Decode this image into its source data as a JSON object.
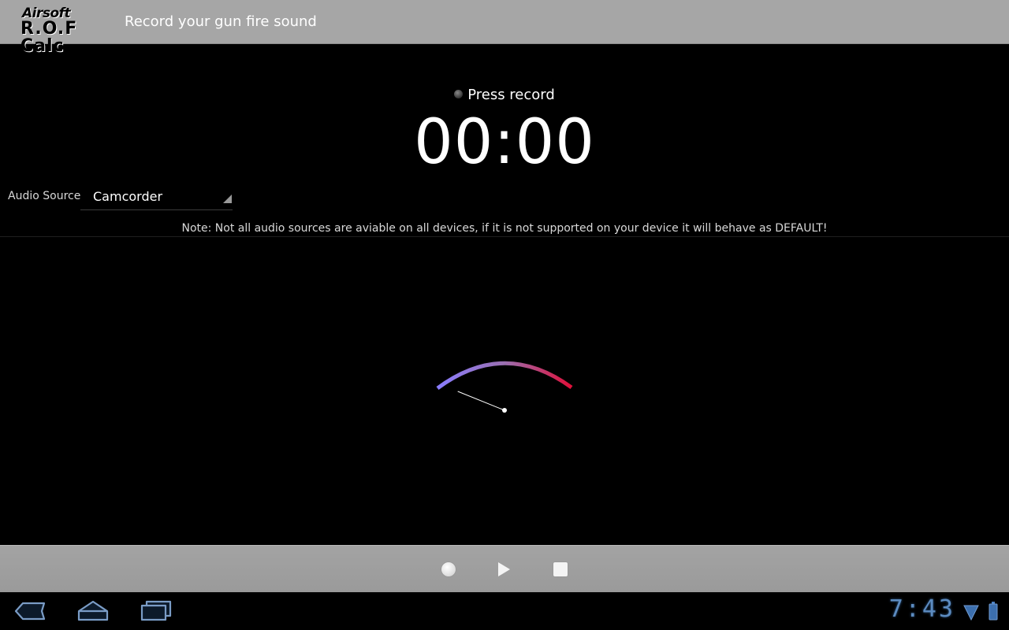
{
  "action_bar": {
    "logo_line1": "Airsoft",
    "logo_line2": "R.O.F Calc",
    "title": "Record your gun fire sound"
  },
  "recorder": {
    "status": "Press record",
    "timer": "00:00"
  },
  "audio_source": {
    "label": "Audio Source",
    "selected": "Camcorder"
  },
  "note": "Note: Not all audio sources are aviable on all devices, if it is not supported on your device it will behave as DEFAULT!",
  "gauge": {
    "level": 0,
    "gradient_start": "#8a7dff",
    "gradient_end": "#e0103a"
  },
  "controls": {
    "record_icon": "record-icon",
    "play_icon": "play-icon",
    "stop_icon": "stop-icon"
  },
  "system_bar": {
    "time": "7:43",
    "accent_color": "#5c8bc0"
  }
}
